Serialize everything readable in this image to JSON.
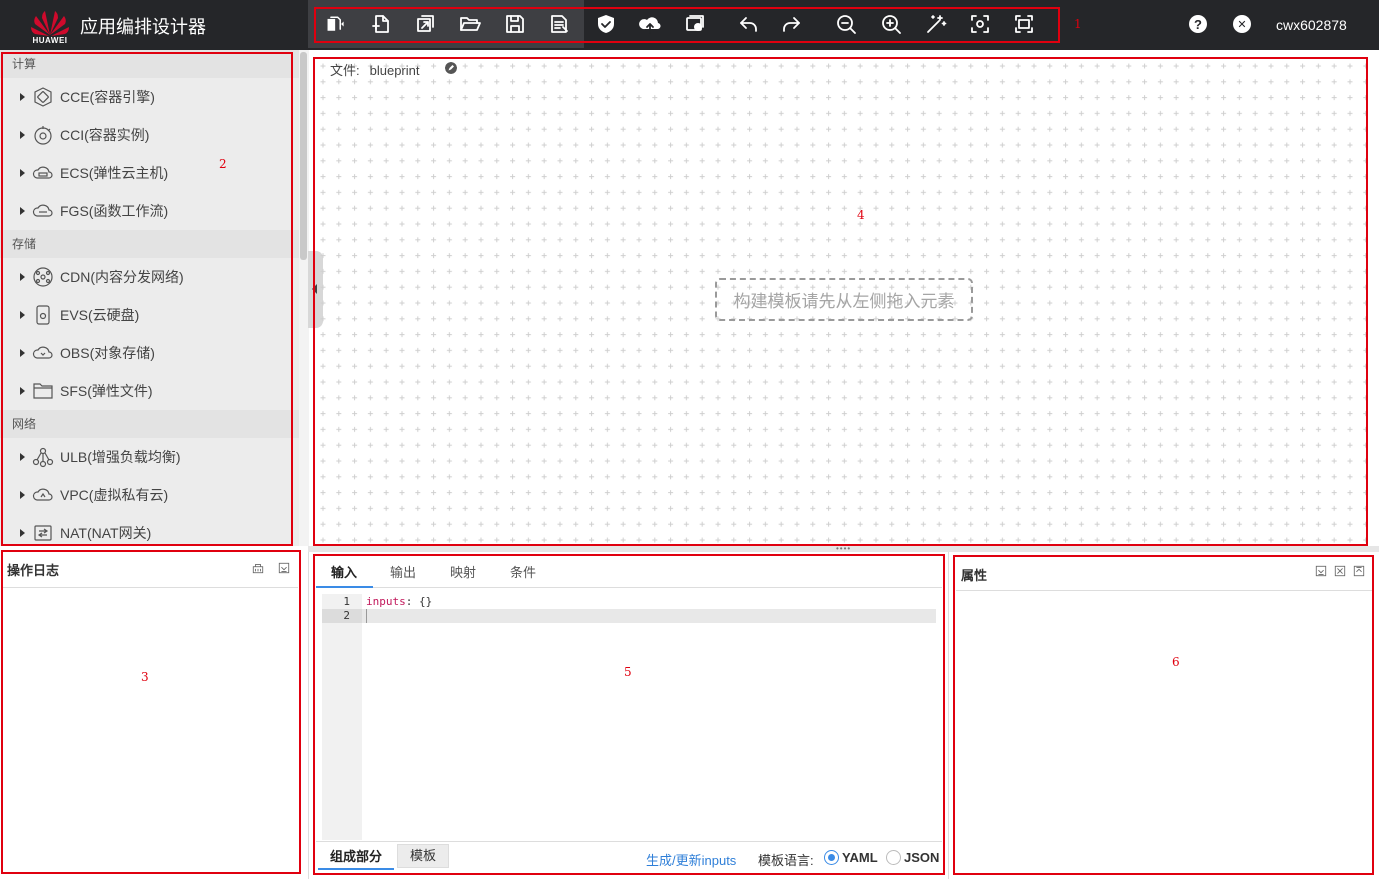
{
  "app": {
    "brand": "HUAWEI",
    "title": "应用编排设计器",
    "username": "cwx602878"
  },
  "toolbar": {
    "buttons": [
      {
        "name": "new-dropdown",
        "icon": "copy-dropdown-icon"
      },
      {
        "name": "new-file",
        "icon": "file-plus-icon"
      },
      {
        "name": "import",
        "icon": "import-icon"
      },
      {
        "name": "open",
        "icon": "folder-open-icon"
      },
      {
        "name": "save",
        "icon": "save-icon"
      },
      {
        "name": "save-as",
        "icon": "save-as-icon"
      },
      {
        "name": "validate",
        "icon": "shield-check-icon"
      },
      {
        "name": "upload",
        "icon": "cloud-upload-icon"
      },
      {
        "name": "deploy",
        "icon": "deploy-icon"
      },
      {
        "name": "undo",
        "icon": "undo-icon"
      },
      {
        "name": "redo",
        "icon": "redo-icon"
      },
      {
        "name": "zoom-out",
        "icon": "zoom-out-icon"
      },
      {
        "name": "zoom-in",
        "icon": "zoom-in-icon"
      },
      {
        "name": "auto-layout",
        "icon": "magic-wand-icon"
      },
      {
        "name": "fit-center",
        "icon": "focus-icon"
      },
      {
        "name": "fullscreen",
        "icon": "fullscreen-icon"
      }
    ],
    "help": "?",
    "close": "✕"
  },
  "annotations": {
    "a1": "1",
    "a2": "2",
    "a3": "3",
    "a4": "4",
    "a5": "5",
    "a6": "6"
  },
  "palette": {
    "categories": [
      {
        "label": "计算",
        "items": [
          {
            "label": "CCE(容器引擎)",
            "icon": "cce-icon"
          },
          {
            "label": "CCI(容器实例)",
            "icon": "cci-icon"
          },
          {
            "label": "ECS(弹性云主机)",
            "icon": "ecs-icon"
          },
          {
            "label": "FGS(函数工作流)",
            "icon": "fgs-icon"
          }
        ]
      },
      {
        "label": "存储",
        "items": [
          {
            "label": "CDN(内容分发网络)",
            "icon": "cdn-icon"
          },
          {
            "label": "EVS(云硬盘)",
            "icon": "evs-icon"
          },
          {
            "label": "OBS(对象存储)",
            "icon": "obs-icon"
          },
          {
            "label": "SFS(弹性文件)",
            "icon": "sfs-icon"
          }
        ]
      },
      {
        "label": "网络",
        "items": [
          {
            "label": "ULB(增强负载均衡)",
            "icon": "ulb-icon"
          },
          {
            "label": "VPC(虚拟私有云)",
            "icon": "vpc-icon"
          },
          {
            "label": "NAT(NAT网关)",
            "icon": "nat-icon"
          }
        ]
      }
    ]
  },
  "canvas": {
    "file_label": "文件:",
    "file_name": "blueprint",
    "placeholder": "构建模板请先从左侧拖入元素"
  },
  "log": {
    "title": "操作日志"
  },
  "editor": {
    "tabs": [
      "输入",
      "输出",
      "映射",
      "条件"
    ],
    "active_tab": "输入",
    "lines": [
      {
        "num": "1",
        "key": "inputs",
        "rest": ": {}"
      },
      {
        "num": "2",
        "key": "",
        "rest": ""
      }
    ],
    "bottom_tabs": [
      "组成部分",
      "模板"
    ],
    "generate_link": "生成/更新inputs",
    "lang_label": "模板语言:",
    "lang_options": [
      {
        "label": "YAML",
        "checked": true
      },
      {
        "label": "JSON",
        "checked": false
      }
    ]
  },
  "props": {
    "title": "属性"
  },
  "colors": {
    "topbar": "#252629",
    "annotation": "#e0000f",
    "accent": "#3a8be6",
    "brand_red": "#cf0a2c"
  }
}
